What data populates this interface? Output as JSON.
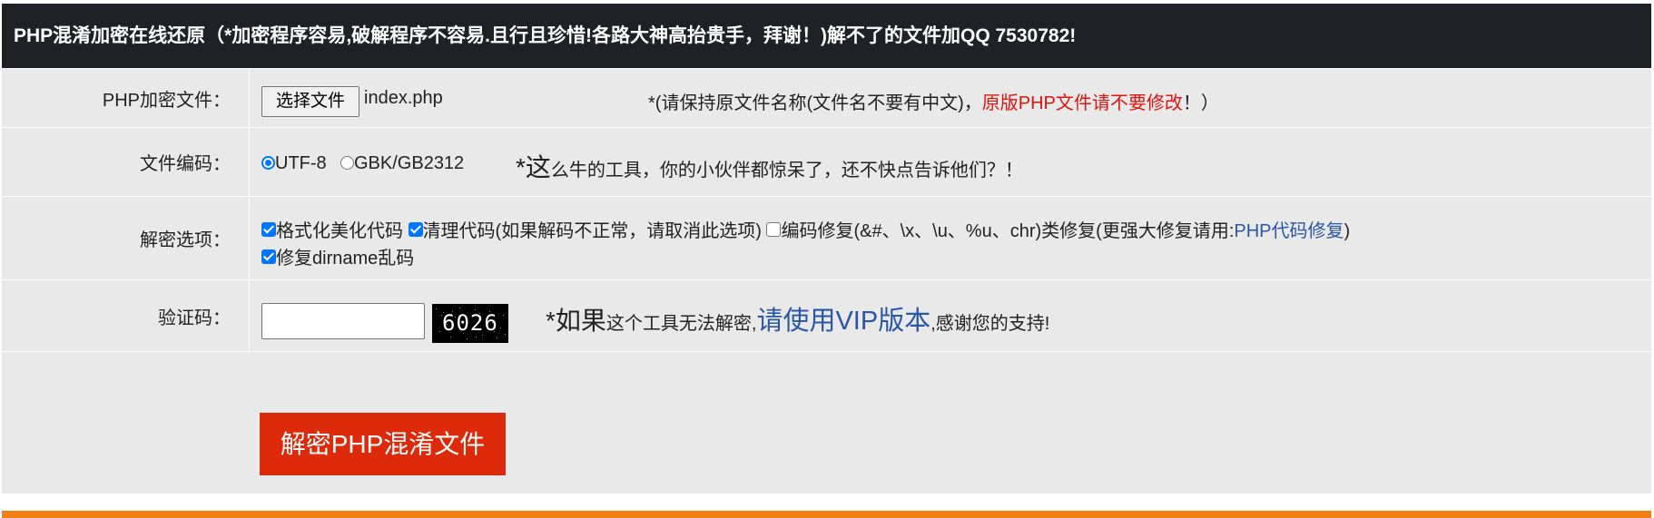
{
  "header": {
    "title": "PHP混淆加密在线还原（*加密程序容易,破解程序不容易.且行且珍惜!各路大神高抬贵手，拜谢！)解不了的文件加QQ 7530782!"
  },
  "file_row": {
    "label": "PHP加密文件：",
    "choose_button": "选择文件",
    "file_name": "index.php",
    "note_prefix": "*(请保持原文件名称(文件名不要有中文)，",
    "note_red": "原版PHP文件请不要修改",
    "note_suffix": "！）"
  },
  "encoding_row": {
    "label": "文件编码：",
    "options": [
      "UTF-8",
      "GBK/GB2312"
    ],
    "selected": "UTF-8",
    "promo_big": "*这",
    "promo_rest": "么牛的工具，你的小伙伴都惊呆了，还不快点告诉他们？！"
  },
  "options_row": {
    "label": "解密选项：",
    "opt_format": "格式化美化代码",
    "opt_clean": "清理代码(如果解码不正常，请取消此选项)",
    "opt_repair": "编码修复(&#、\\x、\\u、%u、chr)类修复(更强大修复请用:",
    "opt_repair_link": "PHP代码修复",
    "opt_repair_close": ")",
    "opt_dirname": "修复dirname乱码",
    "checked": {
      "format": true,
      "clean": true,
      "repair": false,
      "dirname": true
    }
  },
  "captcha_row": {
    "label": "验证码：",
    "input_value": "",
    "captcha_text": "6026",
    "note_big": "*如果",
    "note_small": "这个工具无法解密,",
    "note_link": "请使用VIP版本",
    "note_end": ",感谢您的支持!"
  },
  "submit": {
    "label": "解密PHP混淆文件"
  },
  "colors": {
    "header_bg": "#1e2226",
    "panel_bg": "#e9e9e9",
    "accent_red": "#dc2a0a",
    "link_blue": "#2a56a6",
    "bottom_bar": "#f07f14"
  }
}
